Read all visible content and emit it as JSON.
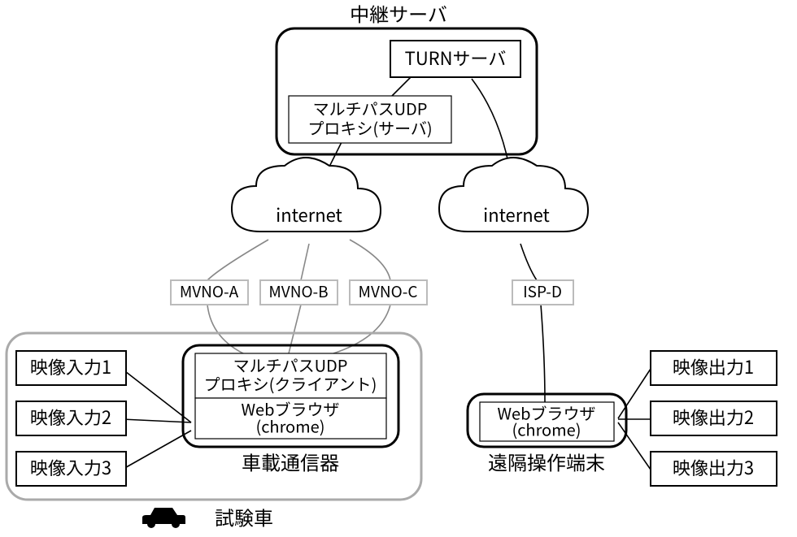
{
  "title_relay": "中継サーバ",
  "turn_server": "TURNサーバ",
  "mpudp_server_l1": "マルチパスUDP",
  "mpudp_server_l2": "プロキシ(サーバ)",
  "internet_left": "internet",
  "internet_right": "internet",
  "mvno_a": "MVNO-A",
  "mvno_b": "MVNO-B",
  "mvno_c": "MVNO-C",
  "isp_d": "ISP-D",
  "mpudp_client_l1": "マルチパスUDP",
  "mpudp_client_l2": "プロキシ(クライアント)",
  "web_browser_l1": "Webブラウザ",
  "web_browser_l2": "(chrome)",
  "video_in_1": "映像入力1",
  "video_in_2": "映像入力2",
  "video_in_3": "映像入力3",
  "video_out_1": "映像出力1",
  "video_out_2": "映像出力2",
  "video_out_3": "映像出力3",
  "onboard_label": "車載通信器",
  "remote_label": "遠隔操作端末",
  "test_car": "試験車",
  "chart_data": {
    "type": "diagram",
    "nodes": [
      {
        "id": "relay_server_group",
        "label": "中継サーバ",
        "children": [
          "turn_server",
          "mpudp_server"
        ]
      },
      {
        "id": "turn_server",
        "label": "TURNサーバ"
      },
      {
        "id": "mpudp_server",
        "label": "マルチパスUDP プロキシ(サーバ)"
      },
      {
        "id": "internet_left",
        "label": "internet"
      },
      {
        "id": "internet_right",
        "label": "internet"
      },
      {
        "id": "mvno_a",
        "label": "MVNO-A"
      },
      {
        "id": "mvno_b",
        "label": "MVNO-B"
      },
      {
        "id": "mvno_c",
        "label": "MVNO-C"
      },
      {
        "id": "isp_d",
        "label": "ISP-D"
      },
      {
        "id": "test_car_group",
        "label": "試験車",
        "children": [
          "video_in_1",
          "video_in_2",
          "video_in_3",
          "onboard_group"
        ]
      },
      {
        "id": "onboard_group",
        "label": "車載通信器",
        "children": [
          "mpudp_client",
          "web_browser_left"
        ]
      },
      {
        "id": "mpudp_client",
        "label": "マルチパスUDP プロキシ(クライアント)"
      },
      {
        "id": "web_browser_left",
        "label": "Webブラウザ (chrome)"
      },
      {
        "id": "video_in_1",
        "label": "映像入力1"
      },
      {
        "id": "video_in_2",
        "label": "映像入力2"
      },
      {
        "id": "video_in_3",
        "label": "映像入力3"
      },
      {
        "id": "remote_group",
        "label": "遠隔操作端末",
        "children": [
          "web_browser_right"
        ]
      },
      {
        "id": "web_browser_right",
        "label": "Webブラウザ (chrome)"
      },
      {
        "id": "video_out_1",
        "label": "映像出力1"
      },
      {
        "id": "video_out_2",
        "label": "映像出力2"
      },
      {
        "id": "video_out_3",
        "label": "映像出力3"
      }
    ],
    "edges": [
      {
        "from": "turn_server",
        "to": "mpudp_server"
      },
      {
        "from": "mpudp_server",
        "to": "internet_left"
      },
      {
        "from": "turn_server",
        "to": "internet_right"
      },
      {
        "from": "internet_left",
        "to": "mvno_a"
      },
      {
        "from": "internet_left",
        "to": "mvno_b"
      },
      {
        "from": "internet_left",
        "to": "mvno_c"
      },
      {
        "from": "mvno_a",
        "to": "mpudp_client"
      },
      {
        "from": "mvno_b",
        "to": "mpudp_client"
      },
      {
        "from": "mvno_c",
        "to": "mpudp_client"
      },
      {
        "from": "internet_right",
        "to": "isp_d"
      },
      {
        "from": "isp_d",
        "to": "web_browser_right"
      },
      {
        "from": "video_in_1",
        "to": "web_browser_left"
      },
      {
        "from": "video_in_2",
        "to": "web_browser_left"
      },
      {
        "from": "video_in_3",
        "to": "web_browser_left"
      },
      {
        "from": "web_browser_right",
        "to": "video_out_1"
      },
      {
        "from": "web_browser_right",
        "to": "video_out_2"
      },
      {
        "from": "web_browser_right",
        "to": "video_out_3"
      }
    ]
  }
}
